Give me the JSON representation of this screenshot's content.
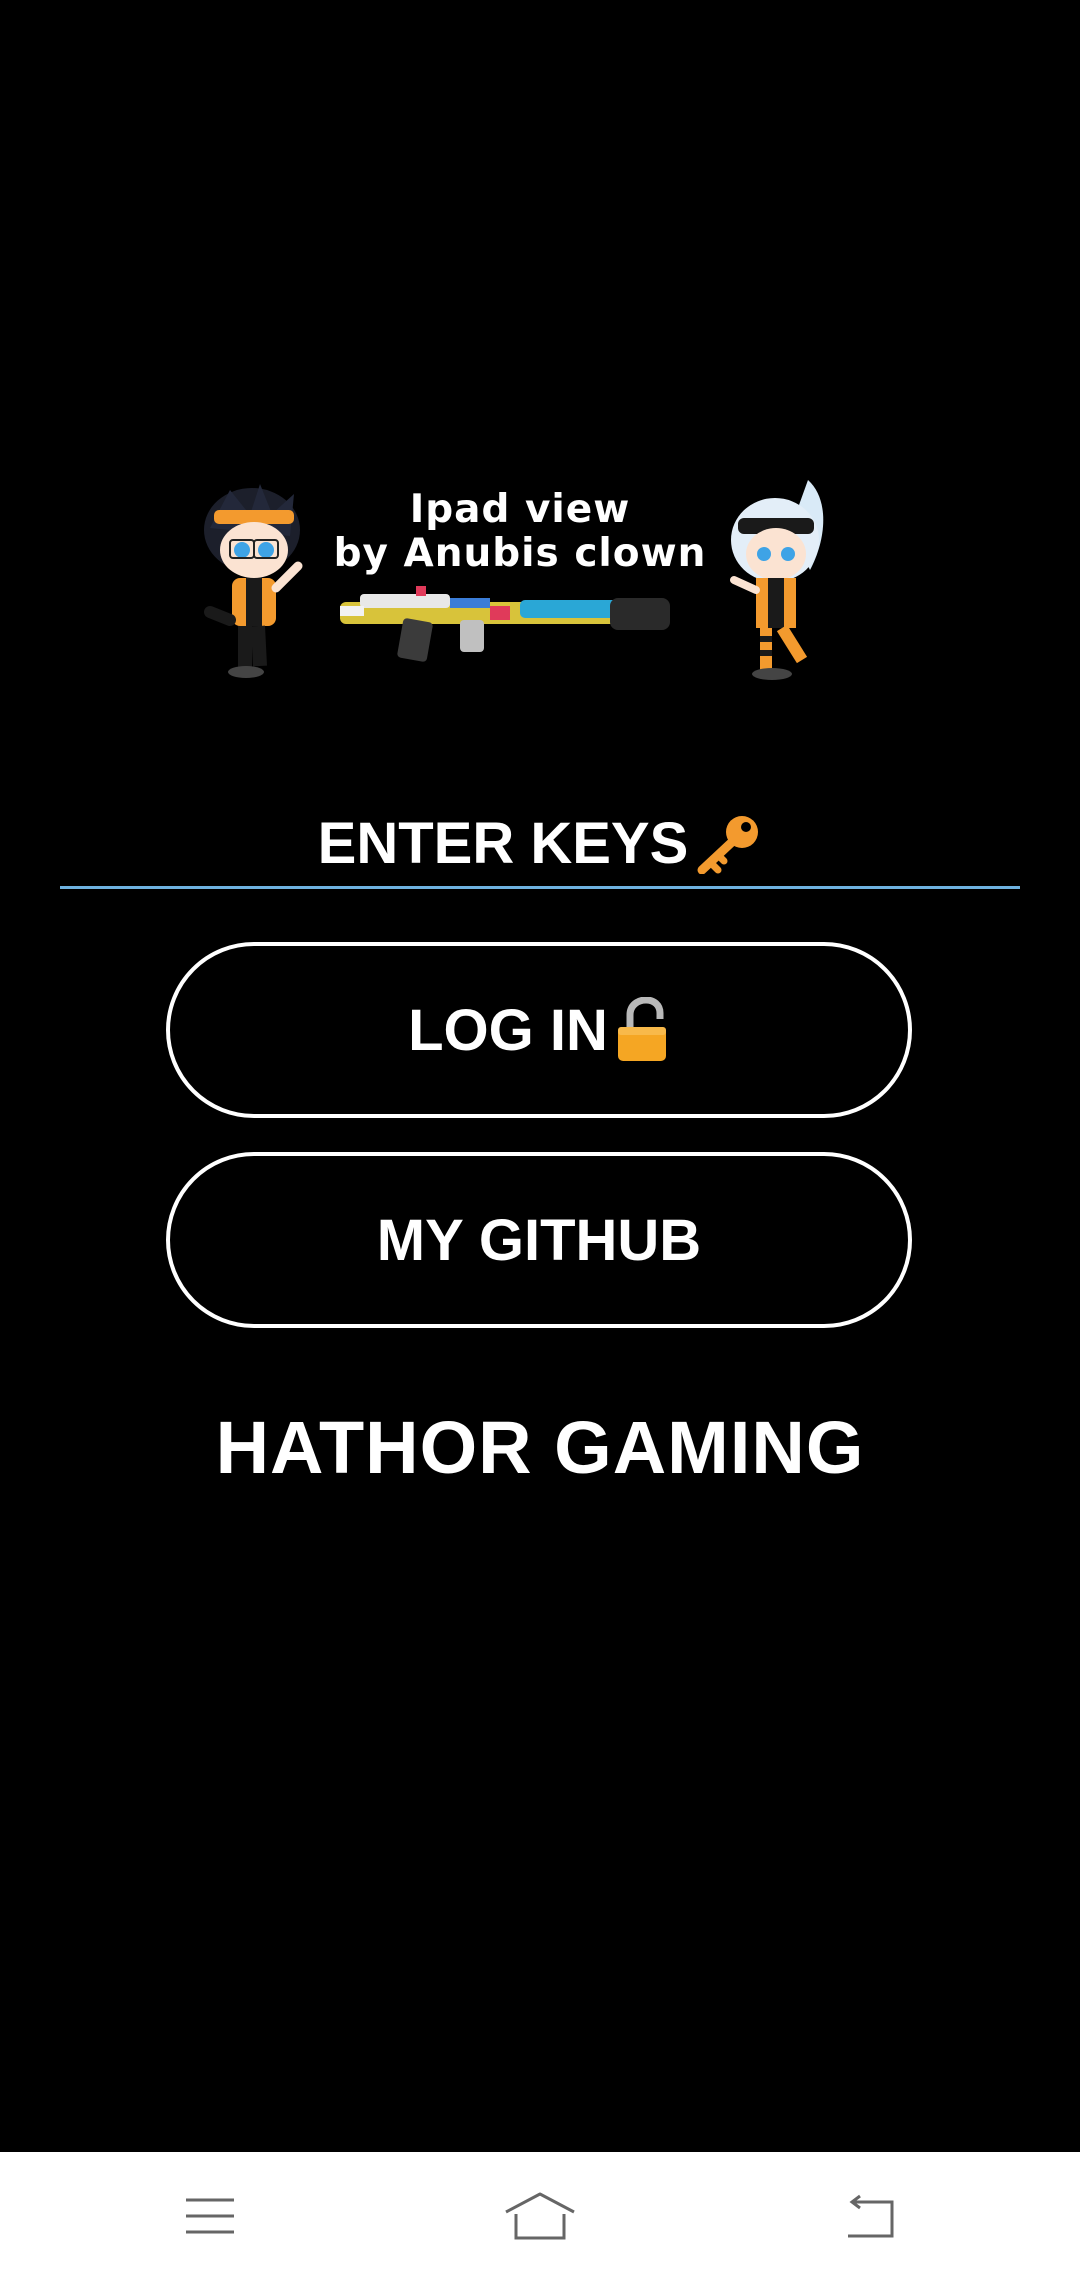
{
  "banner": {
    "line1": "Ipad view",
    "line2": "by Anubis clown"
  },
  "key_input": {
    "placeholder": "ENTER KEYS",
    "icon": "key-icon",
    "underline_color": "#6fb2e0"
  },
  "buttons": {
    "login_label": "LOG IN",
    "login_icon": "unlocked-padlock-icon",
    "github_label": "MY GITHUB"
  },
  "app_title": "HATHOR GAMING",
  "nav_bar": {
    "menu_icon": "menu-icon",
    "home_icon": "home-icon",
    "back_icon": "back-icon"
  },
  "colors": {
    "background": "#000000",
    "text": "#ffffff",
    "accent_orange": "#f39a2e"
  }
}
